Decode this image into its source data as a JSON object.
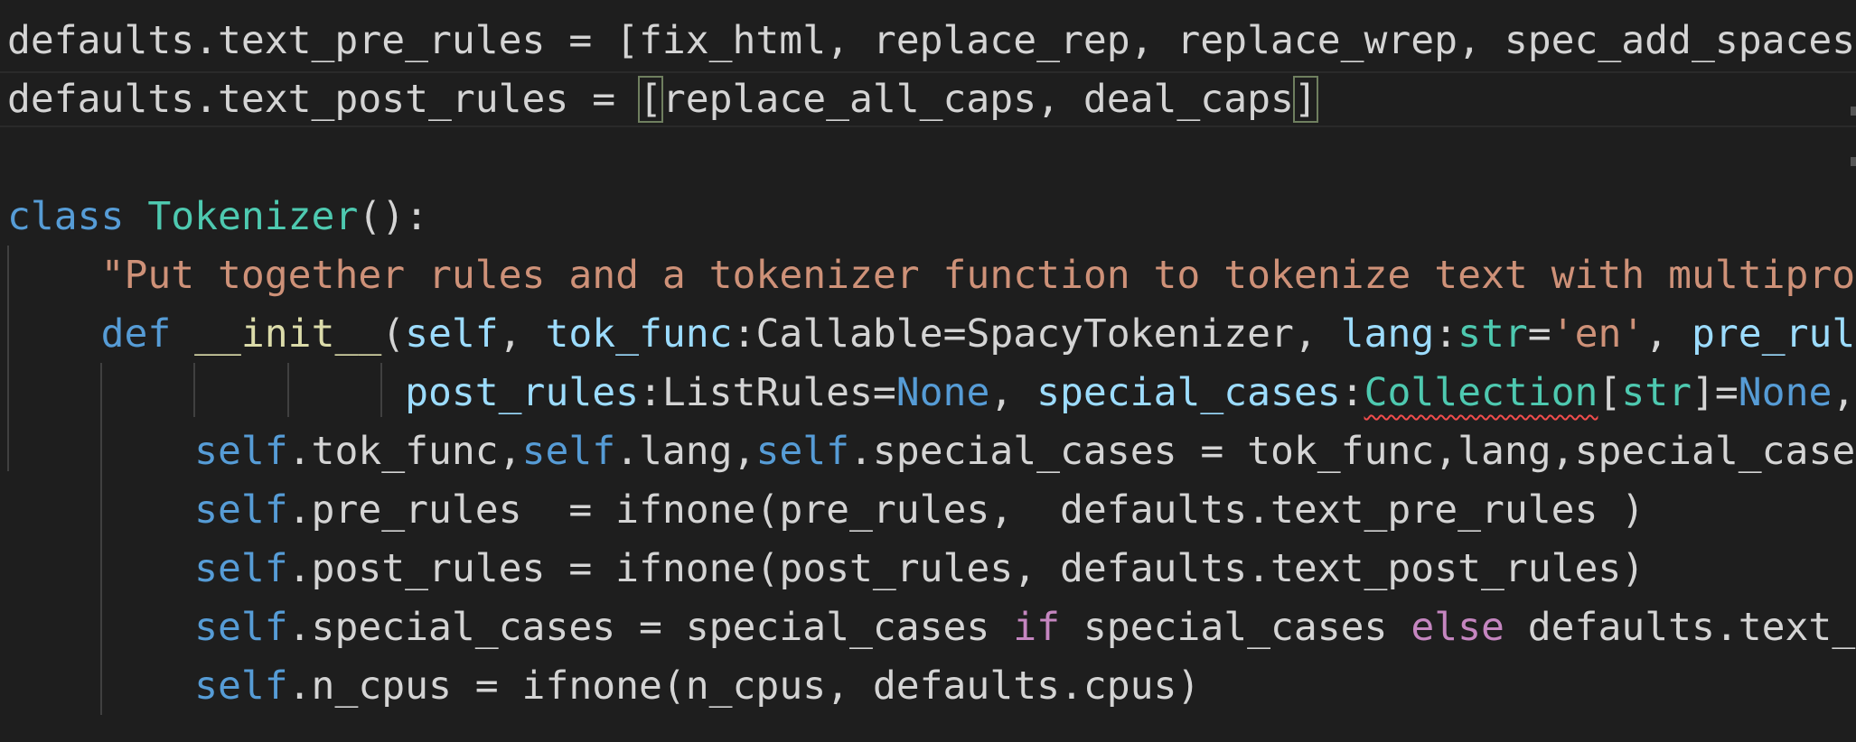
{
  "editor": {
    "colors": {
      "background": "#1e1e1e",
      "text": "#d4d4d4",
      "keyword": "#569cd6",
      "class_name": "#4ec9b0",
      "string": "#ce9178",
      "parameter": "#9cdcfe",
      "control": "#c586c0",
      "error_squiggle": "#f14c4c"
    },
    "lines": [
      {
        "tokens": [
          {
            "text": "defaults.text_pre_rules = [fix_html, replace_rep, replace_wrep, spec_add_spaces",
            "type": "plain"
          }
        ]
      },
      {
        "tokens": [
          {
            "text": "defaults.text_post_rules = ",
            "type": "plain"
          },
          {
            "text": "[",
            "type": "bracket-match"
          },
          {
            "text": "replace_all_caps, deal_caps",
            "type": "plain"
          },
          {
            "text": "]",
            "type": "bracket-match"
          }
        ]
      },
      {
        "tokens": []
      },
      {
        "tokens": [
          {
            "text": "class",
            "type": "kw"
          },
          {
            "text": " ",
            "type": "plain"
          },
          {
            "text": "Tokenizer",
            "type": "class"
          },
          {
            "text": "():",
            "type": "plain"
          }
        ]
      },
      {
        "tokens": [
          {
            "text": "    ",
            "type": "plain"
          },
          {
            "text": "\"Put together rules and a tokenizer function to tokenize text with multipro",
            "type": "str"
          }
        ]
      },
      {
        "tokens": [
          {
            "text": "    ",
            "type": "plain"
          },
          {
            "text": "def",
            "type": "kw"
          },
          {
            "text": " ",
            "type": "plain"
          },
          {
            "text": "__init__",
            "type": "func"
          },
          {
            "text": "(",
            "type": "plain"
          },
          {
            "text": "self",
            "type": "param"
          },
          {
            "text": ", ",
            "type": "plain"
          },
          {
            "text": "tok_func",
            "type": "param"
          },
          {
            "text": ":Callable=SpacyTokenizer, ",
            "type": "plain"
          },
          {
            "text": "lang",
            "type": "param"
          },
          {
            "text": ":",
            "type": "plain"
          },
          {
            "text": "str",
            "type": "builtin"
          },
          {
            "text": "=",
            "type": "plain"
          },
          {
            "text": "'en'",
            "type": "str"
          },
          {
            "text": ", ",
            "type": "plain"
          },
          {
            "text": "pre_rul",
            "type": "param"
          }
        ]
      },
      {
        "tokens": [
          {
            "text": "                 ",
            "type": "plain"
          },
          {
            "text": "post_rules",
            "type": "param"
          },
          {
            "text": ":ListRules=",
            "type": "plain"
          },
          {
            "text": "None",
            "type": "kw"
          },
          {
            "text": ", ",
            "type": "plain"
          },
          {
            "text": "special_cases",
            "type": "param"
          },
          {
            "text": ":",
            "type": "plain"
          },
          {
            "text": "Collection",
            "type": "squiggle"
          },
          {
            "text": "[",
            "type": "plain"
          },
          {
            "text": "str",
            "type": "builtin"
          },
          {
            "text": "]=",
            "type": "plain"
          },
          {
            "text": "None",
            "type": "kw"
          },
          {
            "text": ",",
            "type": "plain"
          }
        ]
      },
      {
        "tokens": [
          {
            "text": "        ",
            "type": "plain"
          },
          {
            "text": "self",
            "type": "kw"
          },
          {
            "text": ".tok_func,",
            "type": "plain"
          },
          {
            "text": "self",
            "type": "kw"
          },
          {
            "text": ".lang,",
            "type": "plain"
          },
          {
            "text": "self",
            "type": "kw"
          },
          {
            "text": ".special_cases = tok_func,lang,special_case",
            "type": "plain"
          }
        ]
      },
      {
        "tokens": [
          {
            "text": "        ",
            "type": "plain"
          },
          {
            "text": "self",
            "type": "kw"
          },
          {
            "text": ".pre_rules  = ifnone(pre_rules,  defaults.text_pre_rules )",
            "type": "plain"
          }
        ]
      },
      {
        "tokens": [
          {
            "text": "        ",
            "type": "plain"
          },
          {
            "text": "self",
            "type": "kw"
          },
          {
            "text": ".post_rules = ifnone(post_rules, defaults.text_post_rules)",
            "type": "plain"
          }
        ]
      },
      {
        "tokens": [
          {
            "text": "        ",
            "type": "plain"
          },
          {
            "text": "self",
            "type": "kw"
          },
          {
            "text": ".special_cases = special_cases ",
            "type": "plain"
          },
          {
            "text": "if",
            "type": "ctrl"
          },
          {
            "text": " special_cases ",
            "type": "plain"
          },
          {
            "text": "else",
            "type": "ctrl"
          },
          {
            "text": " defaults.text_",
            "type": "plain"
          }
        ]
      },
      {
        "tokens": [
          {
            "text": "        ",
            "type": "plain"
          },
          {
            "text": "self",
            "type": "kw"
          },
          {
            "text": ".n_cpus = ifnone(n_cpus, defaults.cpus)",
            "type": "plain"
          }
        ]
      }
    ]
  }
}
